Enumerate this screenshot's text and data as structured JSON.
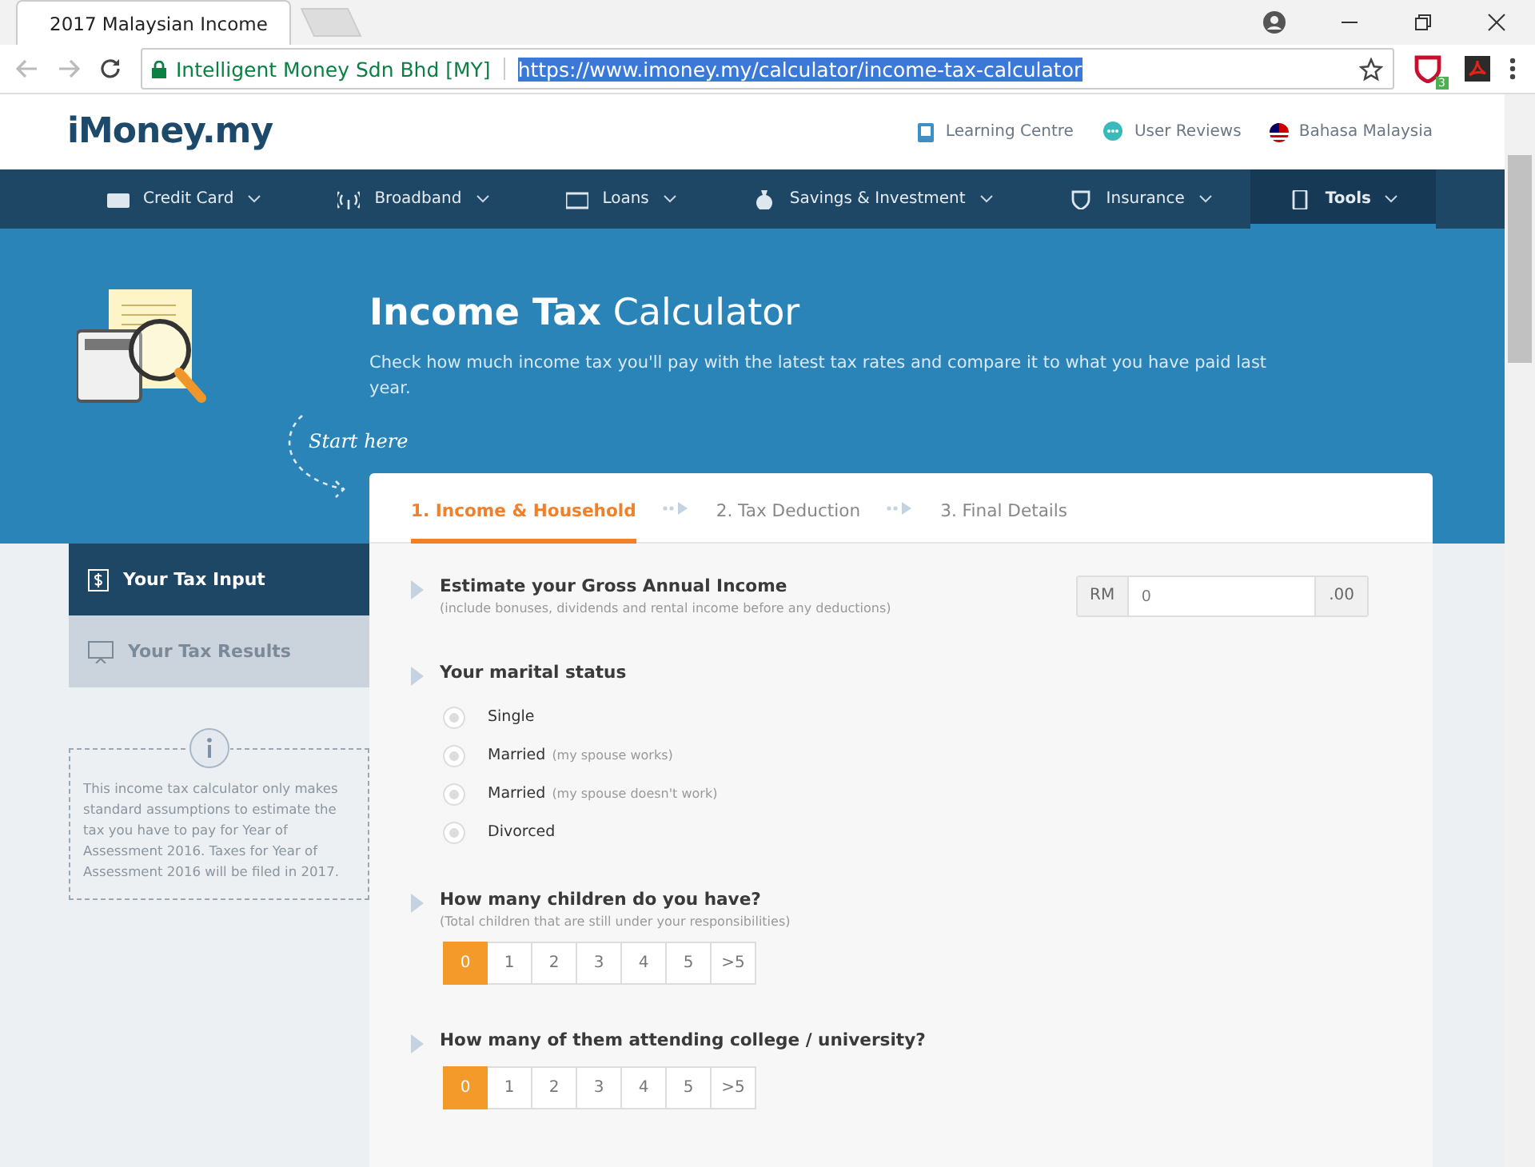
{
  "browser": {
    "tab_title": "2017 Malaysian Income",
    "site_identity": "Intelligent Money Sdn Bhd [MY]",
    "url": "https://www.imoney.my/calculator/income-tax-calculator",
    "extension_badge": "3"
  },
  "header": {
    "logo": "iMoney.my",
    "links": [
      {
        "label": "Learning Centre",
        "kind": "book"
      },
      {
        "label": "User Reviews",
        "kind": "chat"
      },
      {
        "label": "Bahasa Malaysia",
        "kind": "flag"
      }
    ]
  },
  "nav": [
    {
      "label": "Credit Card",
      "kind": "card",
      "selected": false
    },
    {
      "label": "Broadband",
      "kind": "signal",
      "selected": false
    },
    {
      "label": "Loans",
      "kind": "cash",
      "selected": false
    },
    {
      "label": "Savings & Investment",
      "kind": "bag",
      "selected": false
    },
    {
      "label": "Insurance",
      "kind": "shield",
      "selected": false
    },
    {
      "label": "Tools",
      "kind": "calc",
      "selected": true
    }
  ],
  "hero": {
    "title": "**Income Tax** Calculator",
    "subtitle": "Check how much income tax you'll pay with the latest tax rates and compare it to what you have paid last year.",
    "start_label": "Start here"
  },
  "steps": [
    {
      "label": "1. Income & Household",
      "selected": true
    },
    {
      "label": "2. Tax Deduction",
      "selected": false
    },
    {
      "label": "3. Final Details",
      "selected": false
    }
  ],
  "sidebar": {
    "items": [
      {
        "label": "Your Tax Input",
        "kind": "dollar",
        "selected": true
      },
      {
        "label": "Your Tax Results",
        "kind": "screen",
        "selected": false
      }
    ],
    "info": "This income tax calculator only makes standard assumptions to estimate the tax you have to pay for Year of Assessment 2016. Taxes for Year of Assessment 2016 will be filed in 2017."
  },
  "questions": [
    {
      "kind": "money",
      "title": "Estimate your Gross Annual Income",
      "hint": "(include bonuses, dividends and rental income before any deductions)",
      "prefix": "RM",
      "placeholder": "0",
      "suffix": ".00"
    },
    {
      "kind": "radio",
      "title": "Your marital status",
      "options": [
        {
          "label": "Single",
          "selected": false
        },
        {
          "label": "Married",
          "note": "(my spouse works)",
          "selected": false
        },
        {
          "label": "Married",
          "note": "(my spouse doesn't work)",
          "selected": false
        },
        {
          "label": "Divorced",
          "selected": false
        }
      ]
    },
    {
      "kind": "count",
      "title": "How many children do you have?",
      "hint": "(Total children that are still under your responsibilities)",
      "options": [
        {
          "label": "0",
          "selected": true
        },
        {
          "label": "1",
          "selected": false
        },
        {
          "label": "2",
          "selected": false
        },
        {
          "label": "3",
          "selected": false
        },
        {
          "label": "4",
          "selected": false
        },
        {
          "label": "5",
          "selected": false
        },
        {
          "label": ">5",
          "selected": false
        }
      ]
    },
    {
      "kind": "count",
      "title": "How many of them attending college / university?",
      "options": [
        {
          "label": "0",
          "selected": true
        },
        {
          "label": "1",
          "selected": false
        },
        {
          "label": "2",
          "selected": false
        },
        {
          "label": "3",
          "selected": false
        },
        {
          "label": "4",
          "selected": false
        },
        {
          "label": "5",
          "selected": false
        },
        {
          "label": ">5",
          "selected": false
        }
      ]
    }
  ]
}
